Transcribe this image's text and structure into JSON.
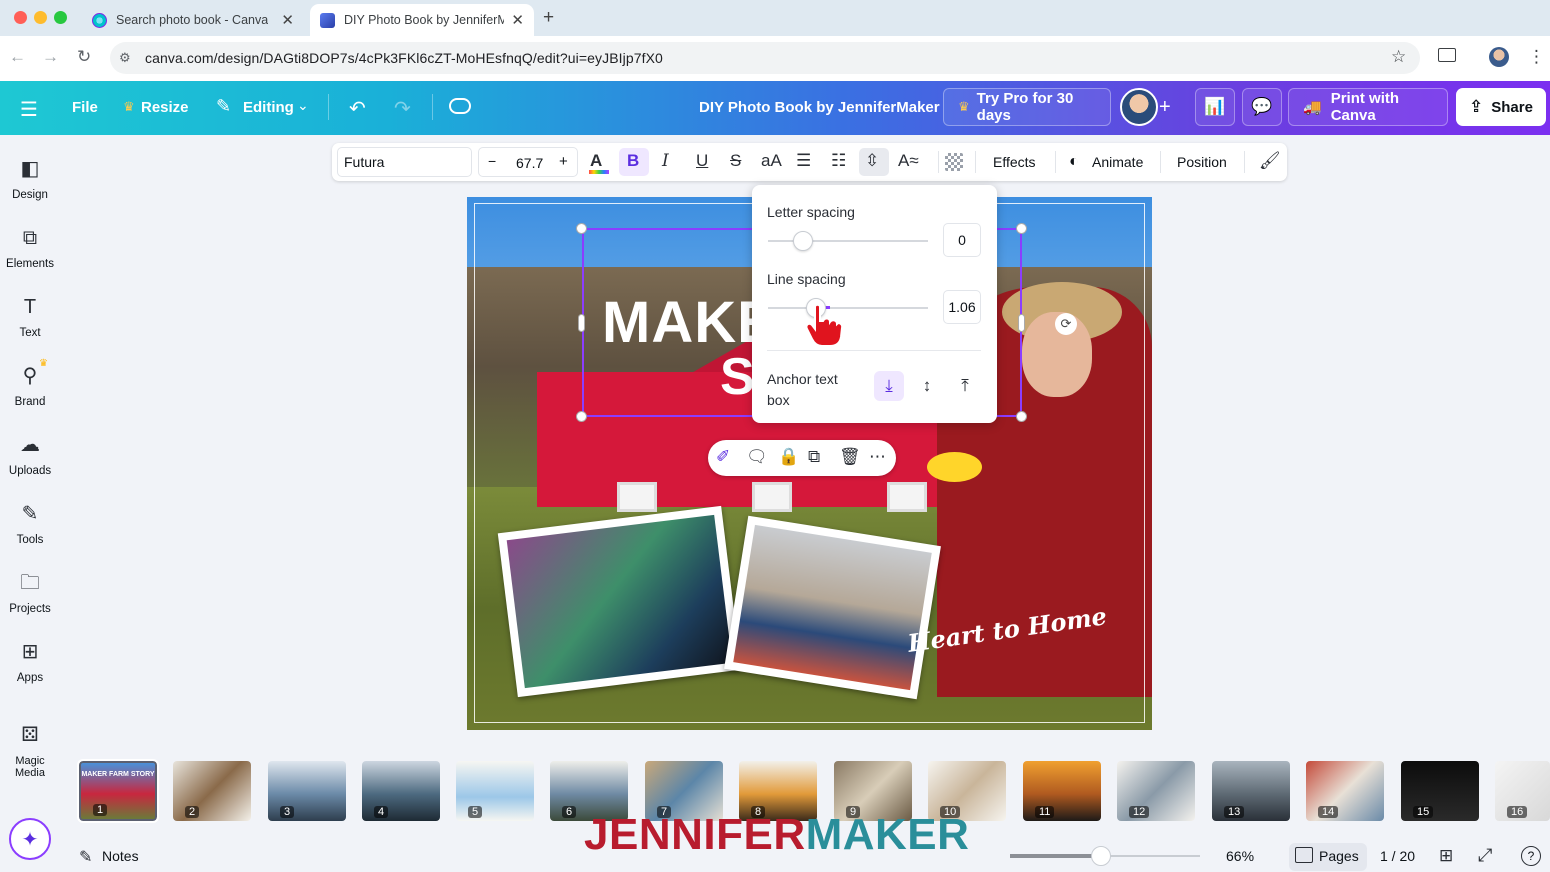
{
  "browser": {
    "tabs": [
      {
        "title": "Search photo book - Canva",
        "active": false
      },
      {
        "title": "DIY Photo Book by JenniferMaker",
        "active": true
      }
    ],
    "url": "canva.com/design/DAGti8DOP7s/4cPk3FKl6cZT-MoHEsfnqQ/edit?ui=eyJBIjp7fX0"
  },
  "topbar": {
    "file_label": "File",
    "resize_label": "Resize",
    "editing_label": "Editing",
    "design_title": "DIY Photo Book by JenniferMaker",
    "try_pro_label": "Try Pro for 30 days",
    "print_label": "Print with Canva",
    "share_label": "Share"
  },
  "sidebar": {
    "items": [
      {
        "label": "Design",
        "icon": "design-icon"
      },
      {
        "label": "Elements",
        "icon": "elements-icon"
      },
      {
        "label": "Text",
        "icon": "text-icon"
      },
      {
        "label": "Brand",
        "icon": "brand-icon"
      },
      {
        "label": "Uploads",
        "icon": "uploads-icon"
      },
      {
        "label": "Tools",
        "icon": "tools-icon"
      },
      {
        "label": "Projects",
        "icon": "projects-icon"
      },
      {
        "label": "Apps",
        "icon": "apps-icon"
      },
      {
        "label": "Magic Media",
        "icon": "magic-media-icon"
      }
    ]
  },
  "toolbar": {
    "font": "Futura",
    "size": "67.7",
    "minus": "−",
    "plus": "+",
    "effects_label": "Effects",
    "animate_label": "Animate",
    "position_label": "Position"
  },
  "spacing_popup": {
    "letter_spacing_label": "Letter spacing",
    "letter_spacing_value": "0",
    "letter_spacing_level": 0.22,
    "line_spacing_label": "Line spacing",
    "line_spacing_value": "1.06",
    "line_spacing_level": 0.3,
    "anchor_label": "Anchor text box"
  },
  "canvas": {
    "title_text": "MAKE",
    "sub_text": "S",
    "script_text": "Heart to Home"
  },
  "pages": {
    "thumbnails": [
      "1",
      "2",
      "3",
      "4",
      "5",
      "6",
      "7",
      "8",
      "9",
      "10",
      "11",
      "12",
      "13",
      "14",
      "15",
      "16"
    ],
    "first_thumb_caption": "MAKER FARM STORY"
  },
  "watermark": {
    "part1": "JENNIFER",
    "part2": "MAKER",
    "color1": "#b81c2e",
    "color2": "#2a8e9a"
  },
  "bottombar": {
    "notes_label": "Notes",
    "zoom_value": "66%",
    "zoom_level": 0.48,
    "pages_label": "Pages",
    "page_counter": "1 / 20"
  },
  "colors": {
    "accent": "#8b3dff",
    "topbar_start": "#1ec8d3",
    "topbar_end": "#7b2ff0"
  }
}
